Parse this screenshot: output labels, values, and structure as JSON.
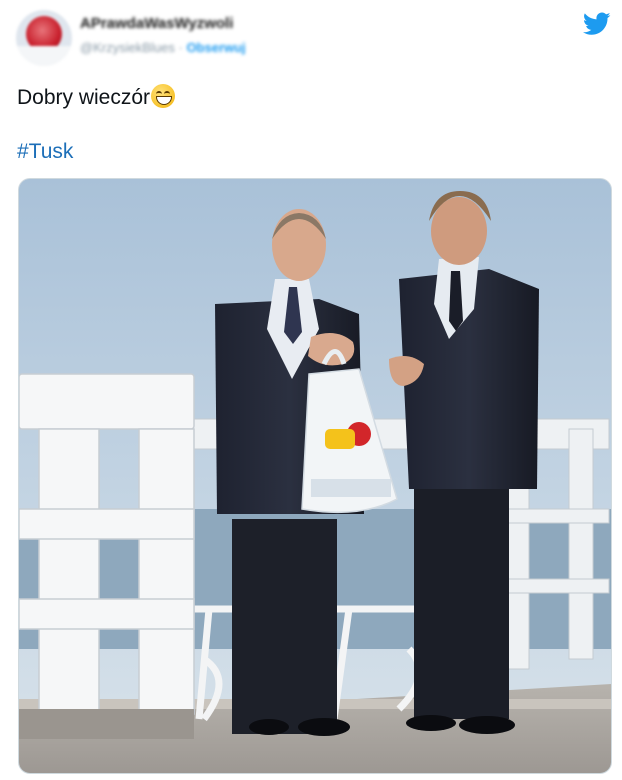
{
  "header": {
    "display_name": "APrawdaWasWyzwoli",
    "handle": "@KrzysiekBlues",
    "separator": "·",
    "follow_label": "Obserwuj"
  },
  "tweet": {
    "text": "Dobry wieczór",
    "emoji": "grinning-face-emoji",
    "hashtag": "#Tusk"
  },
  "media": {
    "description_icon": "photo"
  },
  "colors": {
    "accent": "#1d9bf0",
    "hashtag": "#1d6fb8",
    "text": "#0f1419",
    "muted": "#8899a6"
  }
}
